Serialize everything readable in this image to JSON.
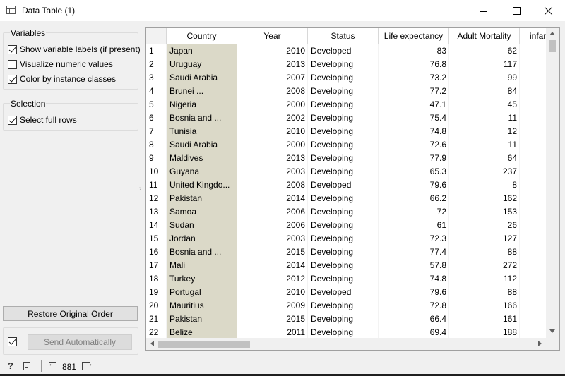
{
  "window": {
    "title": "Data Table (1)"
  },
  "variables": {
    "title": "Variables",
    "options": [
      {
        "label": "Show variable labels (if present)",
        "checked": true
      },
      {
        "label": "Visualize numeric values",
        "checked": false
      },
      {
        "label": "Color by instance classes",
        "checked": true
      }
    ]
  },
  "selection": {
    "title": "Selection",
    "select_full_rows": {
      "label": "Select full rows",
      "checked": true
    }
  },
  "buttons": {
    "restore_label": "Restore Original Order",
    "send_label": "Send Automatically",
    "send_auto_checked": true
  },
  "status": {
    "count": "881"
  },
  "table": {
    "columns": [
      "Country",
      "Year",
      "Status",
      "Life expectancy",
      "Adult Mortality",
      "infan"
    ],
    "rows": [
      [
        "1",
        "Japan",
        "2010",
        "Developed",
        "83",
        "62"
      ],
      [
        "2",
        "Uruguay",
        "2013",
        "Developing",
        "76.8",
        "117"
      ],
      [
        "3",
        "Saudi Arabia",
        "2007",
        "Developing",
        "73.2",
        "99"
      ],
      [
        "4",
        "Brunei ...",
        "2008",
        "Developing",
        "77.2",
        "84"
      ],
      [
        "5",
        "Nigeria",
        "2000",
        "Developing",
        "47.1",
        "45"
      ],
      [
        "6",
        "Bosnia and ...",
        "2002",
        "Developing",
        "75.4",
        "11"
      ],
      [
        "7",
        "Tunisia",
        "2010",
        "Developing",
        "74.8",
        "12"
      ],
      [
        "8",
        "Saudi Arabia",
        "2000",
        "Developing",
        "72.6",
        "11"
      ],
      [
        "9",
        "Maldives",
        "2013",
        "Developing",
        "77.9",
        "64"
      ],
      [
        "10",
        "Guyana",
        "2003",
        "Developing",
        "65.3",
        "237"
      ],
      [
        "11",
        "United Kingdo...",
        "2008",
        "Developed",
        "79.6",
        "8"
      ],
      [
        "12",
        "Pakistan",
        "2014",
        "Developing",
        "66.2",
        "162"
      ],
      [
        "13",
        "Samoa",
        "2006",
        "Developing",
        "72",
        "153"
      ],
      [
        "14",
        "Sudan",
        "2006",
        "Developing",
        "61",
        "26"
      ],
      [
        "15",
        "Jordan",
        "2003",
        "Developing",
        "72.3",
        "127"
      ],
      [
        "16",
        "Bosnia and ...",
        "2015",
        "Developing",
        "77.4",
        "88"
      ],
      [
        "17",
        "Mali",
        "2014",
        "Developing",
        "57.8",
        "272"
      ],
      [
        "18",
        "Turkey",
        "2012",
        "Developing",
        "74.8",
        "112"
      ],
      [
        "19",
        "Portugal",
        "2010",
        "Developed",
        "79.6",
        "88"
      ],
      [
        "20",
        "Mauritius",
        "2009",
        "Developing",
        "72.8",
        "166"
      ],
      [
        "21",
        "Pakistan",
        "2015",
        "Developing",
        "66.4",
        "161"
      ],
      [
        "22",
        "Belize",
        "2011",
        "Developing",
        "69.4",
        "188"
      ]
    ]
  },
  "colors": {
    "class_column_bg": "#dbd9c8"
  },
  "icons": [
    "data-table-icon",
    "help-icon",
    "report-icon",
    "input-icon",
    "output-icon"
  ]
}
